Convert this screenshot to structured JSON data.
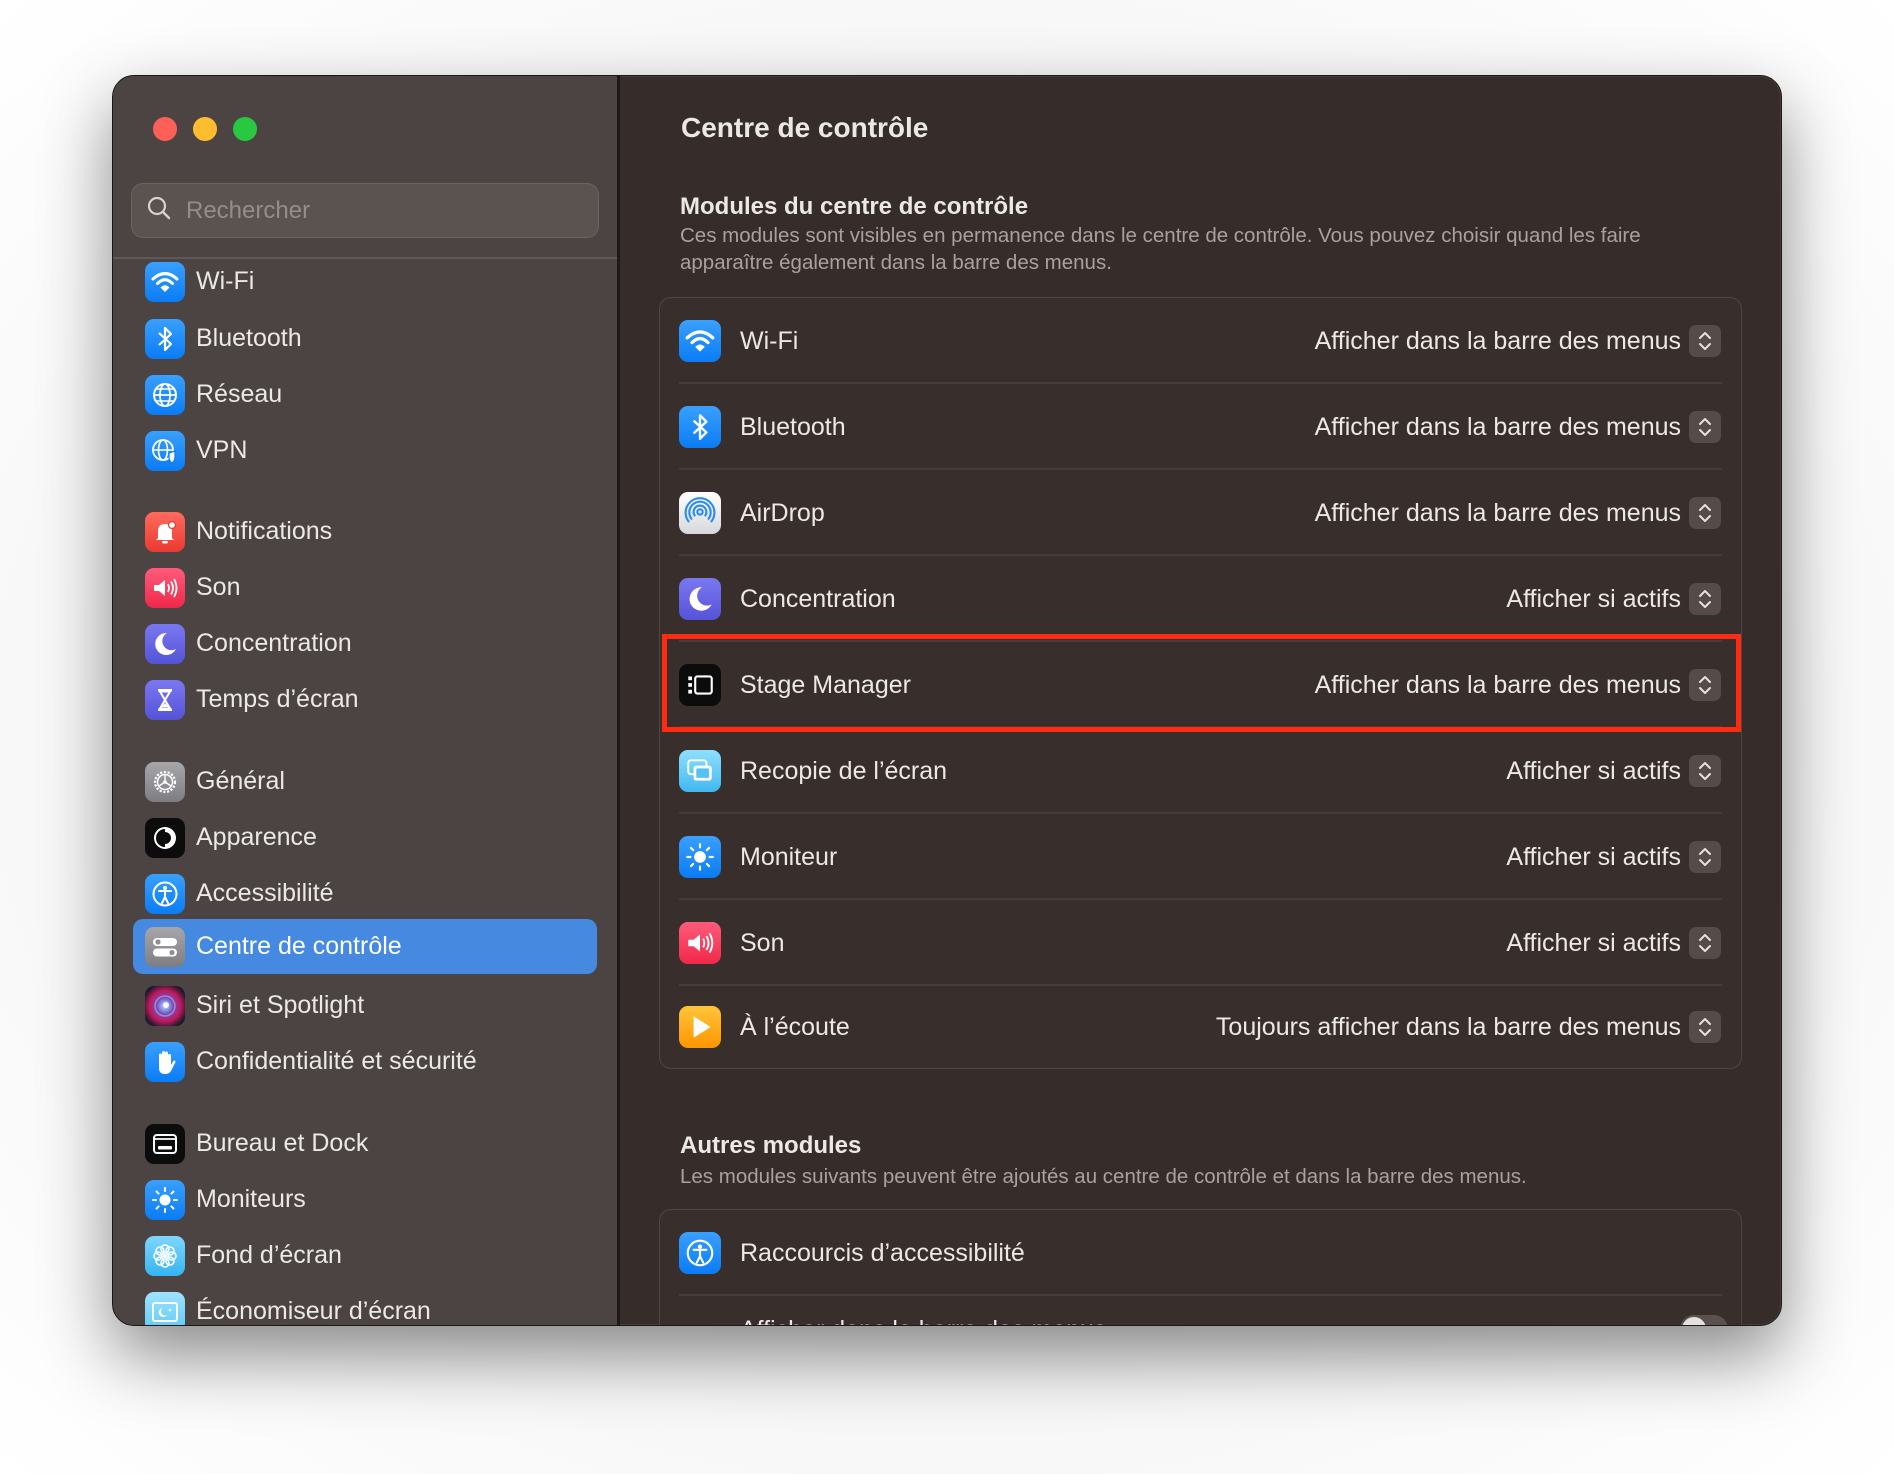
{
  "window": {
    "traffic_lights": [
      "close",
      "minimize",
      "zoom"
    ]
  },
  "sidebar": {
    "search": {
      "placeholder": "Rechercher",
      "value": ""
    },
    "items": [
      {
        "label": "Wi-Fi",
        "icon": "wifi-icon",
        "color": "#1e8cf9"
      },
      {
        "label": "Bluetooth",
        "icon": "bluetooth-icon",
        "color": "#1e8cf9"
      },
      {
        "label": "Réseau",
        "icon": "globe-icon",
        "color": "#1e8cf9"
      },
      {
        "label": "VPN",
        "icon": "vpn-globe-shield-icon",
        "color": "#1e8cf9"
      },
      {
        "label": "Notifications",
        "icon": "bell-icon",
        "color": "#f2463c"
      },
      {
        "label": "Son",
        "icon": "speaker-icon",
        "color": "#f43f5e"
      },
      {
        "label": "Concentration",
        "icon": "moon-icon",
        "color": "#5e5ce6"
      },
      {
        "label": "Temps d’écran",
        "icon": "hourglass-icon",
        "color": "#5e5ce6"
      },
      {
        "label": "Général",
        "icon": "gear-icon",
        "color": "#8e8e93"
      },
      {
        "label": "Apparence",
        "icon": "appearance-icon",
        "color": "#111111"
      },
      {
        "label": "Accessibilité",
        "icon": "accessibility-icon",
        "color": "#1e8cf9"
      },
      {
        "label": "Centre de contrôle",
        "icon": "control-center-icon",
        "color": "#8e8e93",
        "selected": true
      },
      {
        "label": "Siri et Spotlight",
        "icon": "siri-icon",
        "color": "#2a1f3a"
      },
      {
        "label": "Confidentialité et sécurité",
        "icon": "hand-icon",
        "color": "#1e8cf9"
      },
      {
        "label": "Bureau et Dock",
        "icon": "dock-icon",
        "color": "#111111"
      },
      {
        "label": "Moniteurs",
        "icon": "sun-icon",
        "color": "#1e8cf9"
      },
      {
        "label": "Fond d’écran",
        "icon": "flower-icon",
        "color": "#5ac8fa"
      },
      {
        "label": "Économiseur d’écran",
        "icon": "screensaver-icon",
        "color": "#64d2ff"
      }
    ],
    "selected_color": "#4589e0"
  },
  "main": {
    "title": "Centre de contrôle",
    "modules_section": {
      "title": "Modules du centre de contrôle",
      "subtitle": "Ces modules sont visibles en permanence dans le centre de contrôle. Vous pouvez choisir quand les faire apparaître également dans la barre des menus.",
      "rows": [
        {
          "label": "Wi-Fi",
          "icon": "wifi-icon",
          "value": "Afficher dans la barre des menus"
        },
        {
          "label": "Bluetooth",
          "icon": "bluetooth-icon",
          "value": "Afficher dans la barre des menus"
        },
        {
          "label": "AirDrop",
          "icon": "airdrop-icon",
          "value": "Afficher dans la barre des menus"
        },
        {
          "label": "Concentration",
          "icon": "moon-icon",
          "value": "Afficher si actifs"
        },
        {
          "label": "Stage Manager",
          "icon": "stage-manager-icon",
          "value": "Afficher dans la barre des menus",
          "highlighted": true
        },
        {
          "label": "Recopie de l’écran",
          "icon": "screen-mirroring-icon",
          "value": "Afficher si actifs"
        },
        {
          "label": "Moniteur",
          "icon": "sun-icon",
          "value": "Afficher si actifs"
        },
        {
          "label": "Son",
          "icon": "speaker-icon",
          "value": "Afficher si actifs"
        },
        {
          "label": "À l’écoute",
          "icon": "now-playing-icon",
          "value": "Toujours afficher dans la barre des menus"
        }
      ]
    },
    "other_section": {
      "title": "Autres modules",
      "subtitle": "Les modules suivants peuvent être ajoutés au centre de contrôle et dans la barre des menus.",
      "rows": [
        {
          "label": "Raccourcis d’accessibilité",
          "icon": "accessibility-icon"
        }
      ],
      "partial_row": {
        "label": "Afficher dans la barre des menus",
        "toggle_on": false
      }
    },
    "highlight_color": "#ff2a12"
  }
}
